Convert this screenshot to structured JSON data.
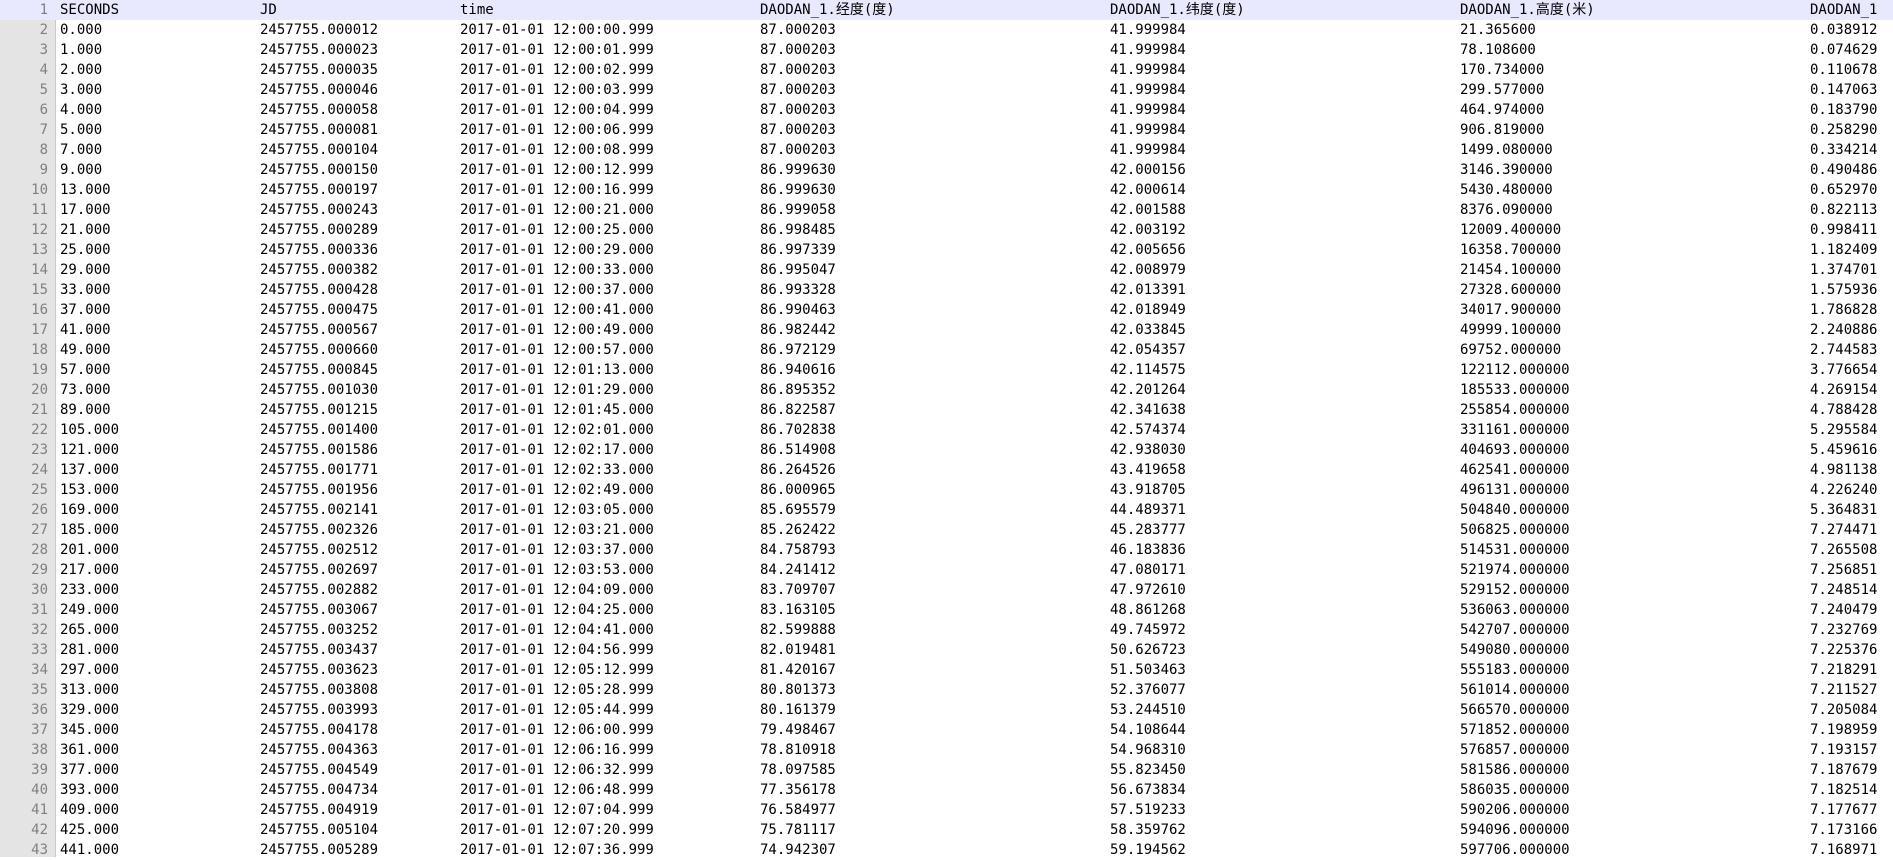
{
  "editor": {
    "header_row": {
      "line_no": "1",
      "cells": [
        "SECONDS",
        "JD",
        "time",
        "DAODAN_1.经度(度)",
        "DAODAN_1.纬度(度)",
        "DAODAN_1.高度(米)",
        "DAODAN_1"
      ]
    },
    "rows": [
      {
        "line_no": "2",
        "cells": [
          "0.000",
          "2457755.000012",
          "2017-01-01 12:00:00.999",
          "87.000203",
          "41.999984",
          "21.365600",
          "0.038912"
        ]
      },
      {
        "line_no": "3",
        "cells": [
          "1.000",
          "2457755.000023",
          "2017-01-01 12:00:01.999",
          "87.000203",
          "41.999984",
          "78.108600",
          "0.074629"
        ]
      },
      {
        "line_no": "4",
        "cells": [
          "2.000",
          "2457755.000035",
          "2017-01-01 12:00:02.999",
          "87.000203",
          "41.999984",
          "170.734000",
          "0.110678"
        ]
      },
      {
        "line_no": "5",
        "cells": [
          "3.000",
          "2457755.000046",
          "2017-01-01 12:00:03.999",
          "87.000203",
          "41.999984",
          "299.577000",
          "0.147063"
        ]
      },
      {
        "line_no": "6",
        "cells": [
          "4.000",
          "2457755.000058",
          "2017-01-01 12:00:04.999",
          "87.000203",
          "41.999984",
          "464.974000",
          "0.183790"
        ]
      },
      {
        "line_no": "7",
        "cells": [
          "5.000",
          "2457755.000081",
          "2017-01-01 12:00:06.999",
          "87.000203",
          "41.999984",
          "906.819000",
          "0.258290"
        ]
      },
      {
        "line_no": "8",
        "cells": [
          "7.000",
          "2457755.000104",
          "2017-01-01 12:00:08.999",
          "87.000203",
          "41.999984",
          "1499.080000",
          "0.334214"
        ]
      },
      {
        "line_no": "9",
        "cells": [
          "9.000",
          "2457755.000150",
          "2017-01-01 12:00:12.999",
          "86.999630",
          "42.000156",
          "3146.390000",
          "0.490486"
        ]
      },
      {
        "line_no": "10",
        "cells": [
          "13.000",
          "2457755.000197",
          "2017-01-01 12:00:16.999",
          "86.999630",
          "42.000614",
          "5430.480000",
          "0.652970"
        ]
      },
      {
        "line_no": "11",
        "cells": [
          "17.000",
          "2457755.000243",
          "2017-01-01 12:00:21.000",
          "86.999058",
          "42.001588",
          "8376.090000",
          "0.822113"
        ]
      },
      {
        "line_no": "12",
        "cells": [
          "21.000",
          "2457755.000289",
          "2017-01-01 12:00:25.000",
          "86.998485",
          "42.003192",
          "12009.400000",
          "0.998411"
        ]
      },
      {
        "line_no": "13",
        "cells": [
          "25.000",
          "2457755.000336",
          "2017-01-01 12:00:29.000",
          "86.997339",
          "42.005656",
          "16358.700000",
          "1.182409"
        ]
      },
      {
        "line_no": "14",
        "cells": [
          "29.000",
          "2457755.000382",
          "2017-01-01 12:00:33.000",
          "86.995047",
          "42.008979",
          "21454.100000",
          "1.374701"
        ]
      },
      {
        "line_no": "15",
        "cells": [
          "33.000",
          "2457755.000428",
          "2017-01-01 12:00:37.000",
          "86.993328",
          "42.013391",
          "27328.600000",
          "1.575936"
        ]
      },
      {
        "line_no": "16",
        "cells": [
          "37.000",
          "2457755.000475",
          "2017-01-01 12:00:41.000",
          "86.990463",
          "42.018949",
          "34017.900000",
          "1.786828"
        ]
      },
      {
        "line_no": "17",
        "cells": [
          "41.000",
          "2457755.000567",
          "2017-01-01 12:00:49.000",
          "86.982442",
          "42.033845",
          "49999.100000",
          "2.240886"
        ]
      },
      {
        "line_no": "18",
        "cells": [
          "49.000",
          "2457755.000660",
          "2017-01-01 12:00:57.000",
          "86.972129",
          "42.054357",
          "69752.000000",
          "2.744583"
        ]
      },
      {
        "line_no": "19",
        "cells": [
          "57.000",
          "2457755.000845",
          "2017-01-01 12:01:13.000",
          "86.940616",
          "42.114575",
          "122112.000000",
          "3.776654"
        ]
      },
      {
        "line_no": "20",
        "cells": [
          "73.000",
          "2457755.001030",
          "2017-01-01 12:01:29.000",
          "86.895352",
          "42.201264",
          "185533.000000",
          "4.269154"
        ]
      },
      {
        "line_no": "21",
        "cells": [
          "89.000",
          "2457755.001215",
          "2017-01-01 12:01:45.000",
          "86.822587",
          "42.341638",
          "255854.000000",
          "4.788428"
        ]
      },
      {
        "line_no": "22",
        "cells": [
          "105.000",
          "2457755.001400",
          "2017-01-01 12:02:01.000",
          "86.702838",
          "42.574374",
          "331161.000000",
          "5.295584"
        ]
      },
      {
        "line_no": "23",
        "cells": [
          "121.000",
          "2457755.001586",
          "2017-01-01 12:02:17.000",
          "86.514908",
          "42.938030",
          "404693.000000",
          "5.459616"
        ]
      },
      {
        "line_no": "24",
        "cells": [
          "137.000",
          "2457755.001771",
          "2017-01-01 12:02:33.000",
          "86.264526",
          "43.419658",
          "462541.000000",
          "4.981138"
        ]
      },
      {
        "line_no": "25",
        "cells": [
          "153.000",
          "2457755.001956",
          "2017-01-01 12:02:49.000",
          "86.000965",
          "43.918705",
          "496131.000000",
          "4.226240"
        ]
      },
      {
        "line_no": "26",
        "cells": [
          "169.000",
          "2457755.002141",
          "2017-01-01 12:03:05.000",
          "85.695579",
          "44.489371",
          "504840.000000",
          "5.364831"
        ]
      },
      {
        "line_no": "27",
        "cells": [
          "185.000",
          "2457755.002326",
          "2017-01-01 12:03:21.000",
          "85.262422",
          "45.283777",
          "506825.000000",
          "7.274471"
        ]
      },
      {
        "line_no": "28",
        "cells": [
          "201.000",
          "2457755.002512",
          "2017-01-01 12:03:37.000",
          "84.758793",
          "46.183836",
          "514531.000000",
          "7.265508"
        ]
      },
      {
        "line_no": "29",
        "cells": [
          "217.000",
          "2457755.002697",
          "2017-01-01 12:03:53.000",
          "84.241412",
          "47.080171",
          "521974.000000",
          "7.256851"
        ]
      },
      {
        "line_no": "30",
        "cells": [
          "233.000",
          "2457755.002882",
          "2017-01-01 12:04:09.000",
          "83.709707",
          "47.972610",
          "529152.000000",
          "7.248514"
        ]
      },
      {
        "line_no": "31",
        "cells": [
          "249.000",
          "2457755.003067",
          "2017-01-01 12:04:25.000",
          "83.163105",
          "48.861268",
          "536063.000000",
          "7.240479"
        ]
      },
      {
        "line_no": "32",
        "cells": [
          "265.000",
          "2457755.003252",
          "2017-01-01 12:04:41.000",
          "82.599888",
          "49.745972",
          "542707.000000",
          "7.232769"
        ]
      },
      {
        "line_no": "33",
        "cells": [
          "281.000",
          "2457755.003437",
          "2017-01-01 12:04:56.999",
          "82.019481",
          "50.626723",
          "549080.000000",
          "7.225376"
        ]
      },
      {
        "line_no": "34",
        "cells": [
          "297.000",
          "2457755.003623",
          "2017-01-01 12:05:12.999",
          "81.420167",
          "51.503463",
          "555183.000000",
          "7.218291"
        ]
      },
      {
        "line_no": "35",
        "cells": [
          "313.000",
          "2457755.003808",
          "2017-01-01 12:05:28.999",
          "80.801373",
          "52.376077",
          "561014.000000",
          "7.211527"
        ]
      },
      {
        "line_no": "36",
        "cells": [
          "329.000",
          "2457755.003993",
          "2017-01-01 12:05:44.999",
          "80.161379",
          "53.244510",
          "566570.000000",
          "7.205084"
        ]
      },
      {
        "line_no": "37",
        "cells": [
          "345.000",
          "2457755.004178",
          "2017-01-01 12:06:00.999",
          "79.498467",
          "54.108644",
          "571852.000000",
          "7.198959"
        ]
      },
      {
        "line_no": "38",
        "cells": [
          "361.000",
          "2457755.004363",
          "2017-01-01 12:06:16.999",
          "78.810918",
          "54.968310",
          "576857.000000",
          "7.193157"
        ]
      },
      {
        "line_no": "39",
        "cells": [
          "377.000",
          "2457755.004549",
          "2017-01-01 12:06:32.999",
          "78.097585",
          "55.823450",
          "581586.000000",
          "7.187679"
        ]
      },
      {
        "line_no": "40",
        "cells": [
          "393.000",
          "2457755.004734",
          "2017-01-01 12:06:48.999",
          "77.356178",
          "56.673834",
          "586035.000000",
          "7.182514"
        ]
      },
      {
        "line_no": "41",
        "cells": [
          "409.000",
          "2457755.004919",
          "2017-01-01 12:07:04.999",
          "76.584977",
          "57.519233",
          "590206.000000",
          "7.177677"
        ]
      },
      {
        "line_no": "42",
        "cells": [
          "425.000",
          "2457755.005104",
          "2017-01-01 12:07:20.999",
          "75.781117",
          "58.359762",
          "594096.000000",
          "7.173166"
        ]
      },
      {
        "line_no": "43",
        "cells": [
          "441.000",
          "2457755.005289",
          "2017-01-01 12:07:36.999",
          "74.942307",
          "59.194562",
          "597706.000000",
          "7.168971"
        ]
      }
    ]
  }
}
